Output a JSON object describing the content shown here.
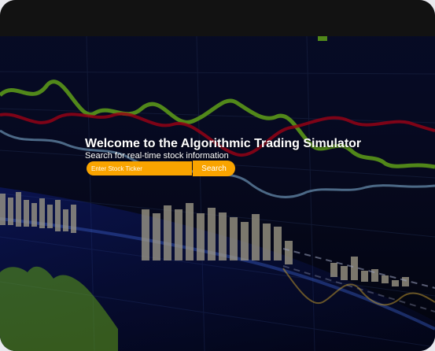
{
  "hero": {
    "title": "Welcome to the Algorithmic Trading Simulator",
    "subtitle": "Search for real-time stock information"
  },
  "search": {
    "placeholder": "Enter Stock Ticker",
    "button_label": "Search"
  },
  "colors": {
    "accent": "#f9a400",
    "background": "#070a22",
    "topbar": "#121212"
  }
}
